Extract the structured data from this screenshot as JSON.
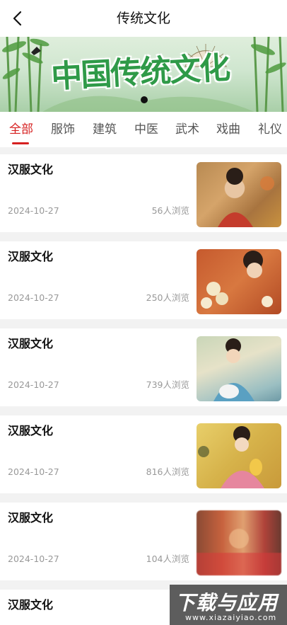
{
  "header": {
    "title": "传统文化",
    "back_icon": "back-arrow-icon"
  },
  "banner": {
    "text": "中国传统文化",
    "page_indicator_active": 1
  },
  "tabs": [
    {
      "label": "全部",
      "active": true
    },
    {
      "label": "服饰",
      "active": false
    },
    {
      "label": "建筑",
      "active": false
    },
    {
      "label": "中医",
      "active": false
    },
    {
      "label": "武术",
      "active": false
    },
    {
      "label": "戏曲",
      "active": false
    },
    {
      "label": "礼仪",
      "active": false
    }
  ],
  "articles": [
    {
      "title": "汉服文化",
      "date": "2024-10-27",
      "views": "56人浏览"
    },
    {
      "title": "汉服文化",
      "date": "2024-10-27",
      "views": "250人浏览"
    },
    {
      "title": "汉服文化",
      "date": "2024-10-27",
      "views": "739人浏览"
    },
    {
      "title": "汉服文化",
      "date": "2024-10-27",
      "views": "816人浏览"
    },
    {
      "title": "汉服文化",
      "date": "2024-10-27",
      "views": "104人浏览"
    },
    {
      "title": "汉服文化"
    }
  ],
  "watermark": {
    "text": "下载与应用",
    "url": "www.xiazaiyiao.com"
  },
  "colors": {
    "accent": "#d62020",
    "background": "#f2f2f2"
  }
}
